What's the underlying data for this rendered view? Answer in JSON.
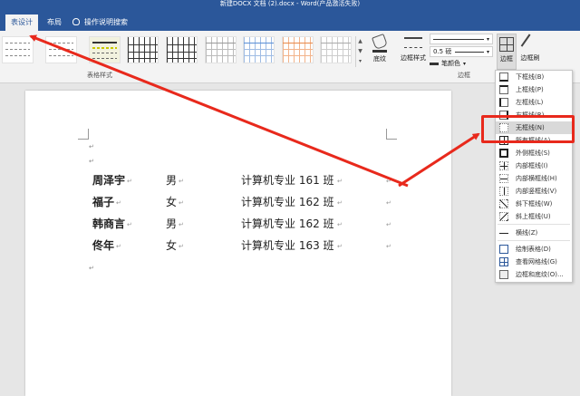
{
  "window": {
    "title": "新建DOCX 文档 (2).docx - Word(产品激活失败)"
  },
  "tabs": [
    {
      "label": "表设计",
      "active": true
    },
    {
      "label": "布局",
      "active": false
    }
  ],
  "tell_me": {
    "label": "操作说明搜索",
    "icon": "lightbulb-icon"
  },
  "ribbon": {
    "table_styles_group": "表格样式",
    "shading_label": "底纹",
    "border_styles_label": "边框样式",
    "line_weight": "0.5 磅",
    "pen_color_label": "笔颜色",
    "borders_group": "边框",
    "borders_button": "边框",
    "border_painter": "边框刷"
  },
  "document": {
    "rows": [
      [
        "周泽宇",
        "男",
        "计算机专业 161 班"
      ],
      [
        "福子",
        "女",
        "计算机专业 162 班"
      ],
      [
        "韩商言",
        "男",
        "计算机专业 162 班"
      ],
      [
        "佟年",
        "女",
        "计算机专业 163 班"
      ]
    ]
  },
  "border_menu": {
    "items": [
      {
        "label": "下框线(B)",
        "icon": "bottom-border-icon"
      },
      {
        "label": "上框线(P)",
        "icon": "top-border-icon"
      },
      {
        "label": "左框线(L)",
        "icon": "left-border-icon"
      },
      {
        "label": "右框线(R)",
        "icon": "right-border-icon"
      },
      {
        "label": "无框线(N)",
        "icon": "no-border-icon",
        "highlighted": true
      },
      {
        "label": "所有框线(A)",
        "icon": "all-borders-icon"
      },
      {
        "label": "外侧框线(S)",
        "icon": "outside-borders-icon"
      },
      {
        "label": "内部框线(I)",
        "icon": "inside-borders-icon"
      },
      {
        "label": "内部横框线(H)",
        "icon": "inside-horizontal-border-icon"
      },
      {
        "label": "内部竖框线(V)",
        "icon": "inside-vertical-border-icon"
      },
      {
        "label": "斜下框线(W)",
        "icon": "diagonal-down-border-icon"
      },
      {
        "label": "斜上框线(U)",
        "icon": "diagonal-up-border-icon"
      },
      {
        "label": "横线(Z)",
        "icon": "horizontal-line-icon"
      },
      {
        "label": "绘制表格(D)",
        "icon": "draw-table-icon"
      },
      {
        "label": "查看网格线(G)",
        "icon": "view-gridlines-icon"
      },
      {
        "label": "边框和底纹(O)...",
        "icon": "borders-shading-icon"
      }
    ]
  },
  "colors": {
    "accent": "#2b579a",
    "annotation": "#e8291c"
  }
}
